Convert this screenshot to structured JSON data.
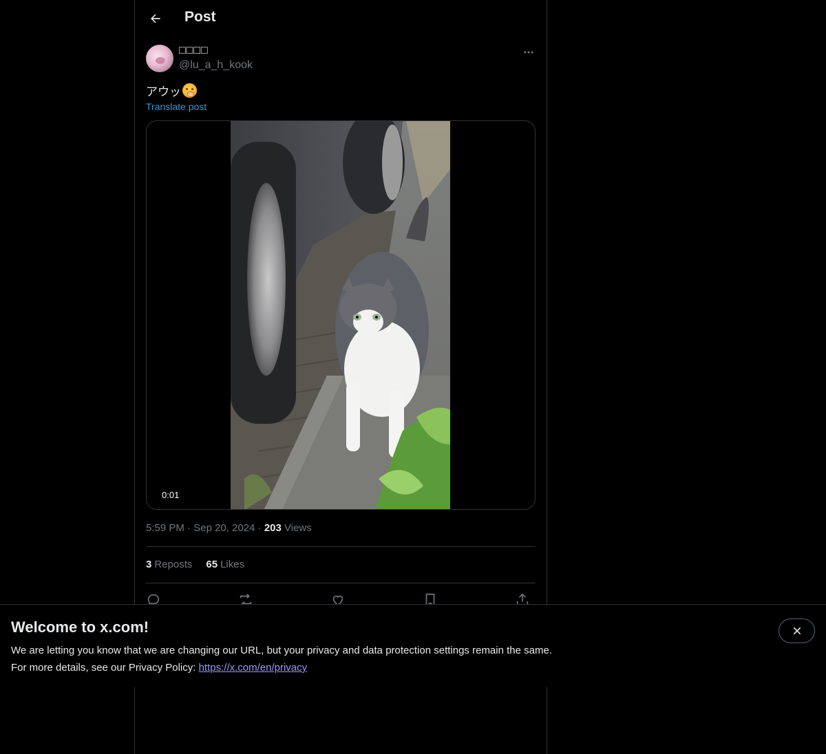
{
  "header": {
    "title": "Post"
  },
  "author": {
    "display_name": "□□□□",
    "handle": "@lu_a_h_kook"
  },
  "post": {
    "text": "アウッ",
    "emoji_icon": "face-with-hand-over-mouth-icon",
    "translate_label": "Translate post",
    "video_duration": "0:01"
  },
  "meta": {
    "time": "5:59 PM",
    "separator": "·",
    "date": "Sep 20, 2024",
    "views_count": "203",
    "views_label": "Views"
  },
  "stats": {
    "reposts_count": "3",
    "reposts_label": "Reposts",
    "likes_count": "65",
    "likes_label": "Likes"
  },
  "actions": [
    "reply-icon",
    "repost-icon",
    "like-icon",
    "bookmark-icon",
    "share-icon"
  ],
  "banner": {
    "title": "Welcome to x.com!",
    "line1": "We are letting you know that we are changing our URL, but your privacy and data protection settings remain the same.",
    "line2_prefix": "For more details, see our Privacy Policy: ",
    "link": "https://x.com/en/privacy"
  },
  "colors": {
    "background": "#000000",
    "text": "#e7e9ea",
    "muted": "#71767b",
    "accent": "#1d9bf0",
    "border": "#2f3336",
    "link": "#9b96f5"
  }
}
